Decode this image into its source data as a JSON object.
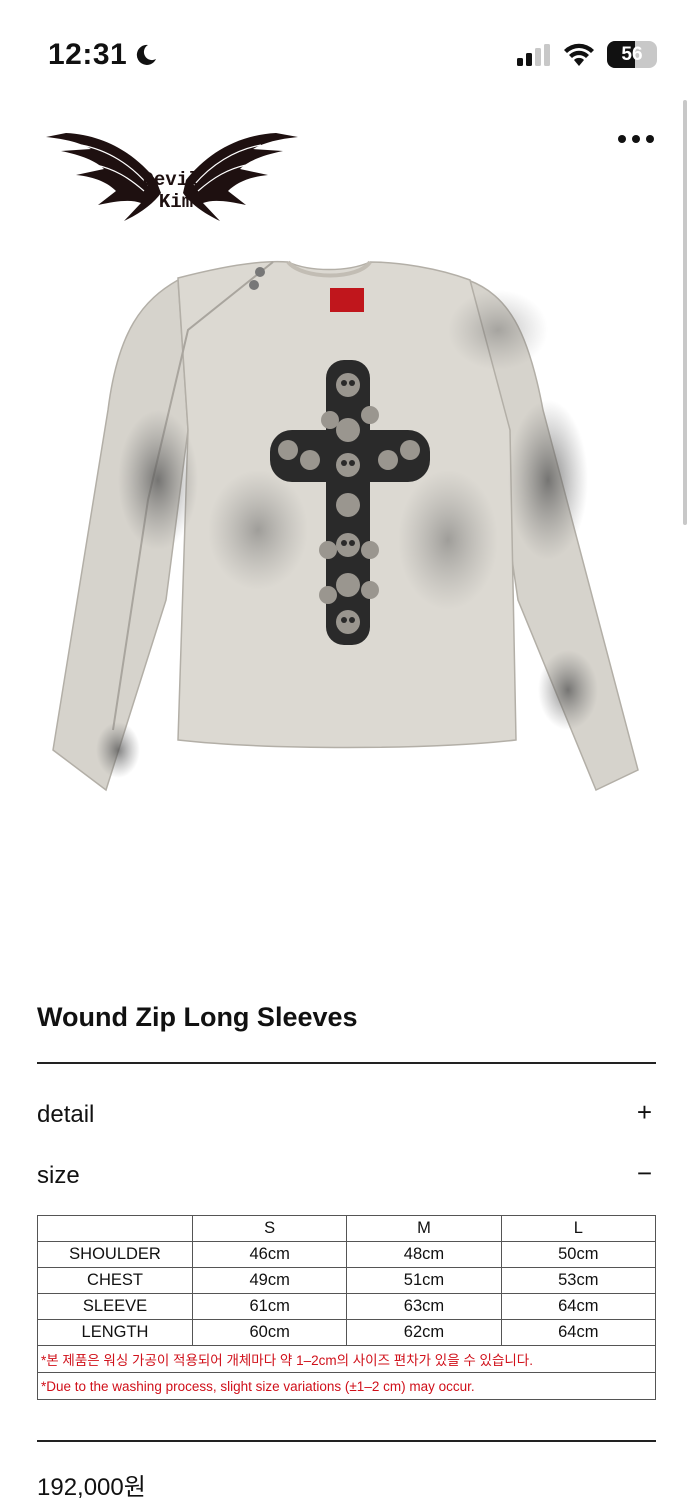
{
  "status_bar": {
    "time": "12:31",
    "battery": "56",
    "battery_level": 0.56
  },
  "icons": {
    "moon": "moon-icon",
    "signal": "cellular-signal-icon",
    "wifi": "wifi-icon",
    "battery": "battery-icon",
    "more": "more-horizontal-icon",
    "logo": "devil-wings-logo",
    "product": "long-sleeve-shirt-skull-cross-image"
  },
  "brand": {
    "logo_text_line1": "Devil",
    "logo_text_line2": "Kim"
  },
  "product": {
    "title": "Wound Zip Long Sleeves",
    "price": "192,000원"
  },
  "sections": {
    "detail": {
      "label": "detail",
      "toggle": "+"
    },
    "size": {
      "label": "size",
      "toggle": "−"
    }
  },
  "size_table": {
    "headers": [
      "",
      "S",
      "M",
      "L"
    ],
    "rows": [
      {
        "label": "SHOULDER",
        "values": [
          "46cm",
          "48cm",
          "50cm"
        ]
      },
      {
        "label": "CHEST",
        "values": [
          "49cm",
          "51cm",
          "53cm"
        ]
      },
      {
        "label": "SLEEVE",
        "values": [
          "61cm",
          "63cm",
          "64cm"
        ]
      },
      {
        "label": "LENGTH",
        "values": [
          "60cm",
          "62cm",
          "64cm"
        ]
      }
    ],
    "note_ko": "*본 제품은 워싱 가공이 적용되어 개체마다 약 1–2cm의 사이즈 편차가 있을 수 있습니다.",
    "note_en": "*Due to the washing process, slight size variations (±1–2 cm) may occur."
  },
  "colors": {
    "note_red": "#d0101a",
    "shirt": "#d9d6cf",
    "print": "#2a2a2a"
  }
}
